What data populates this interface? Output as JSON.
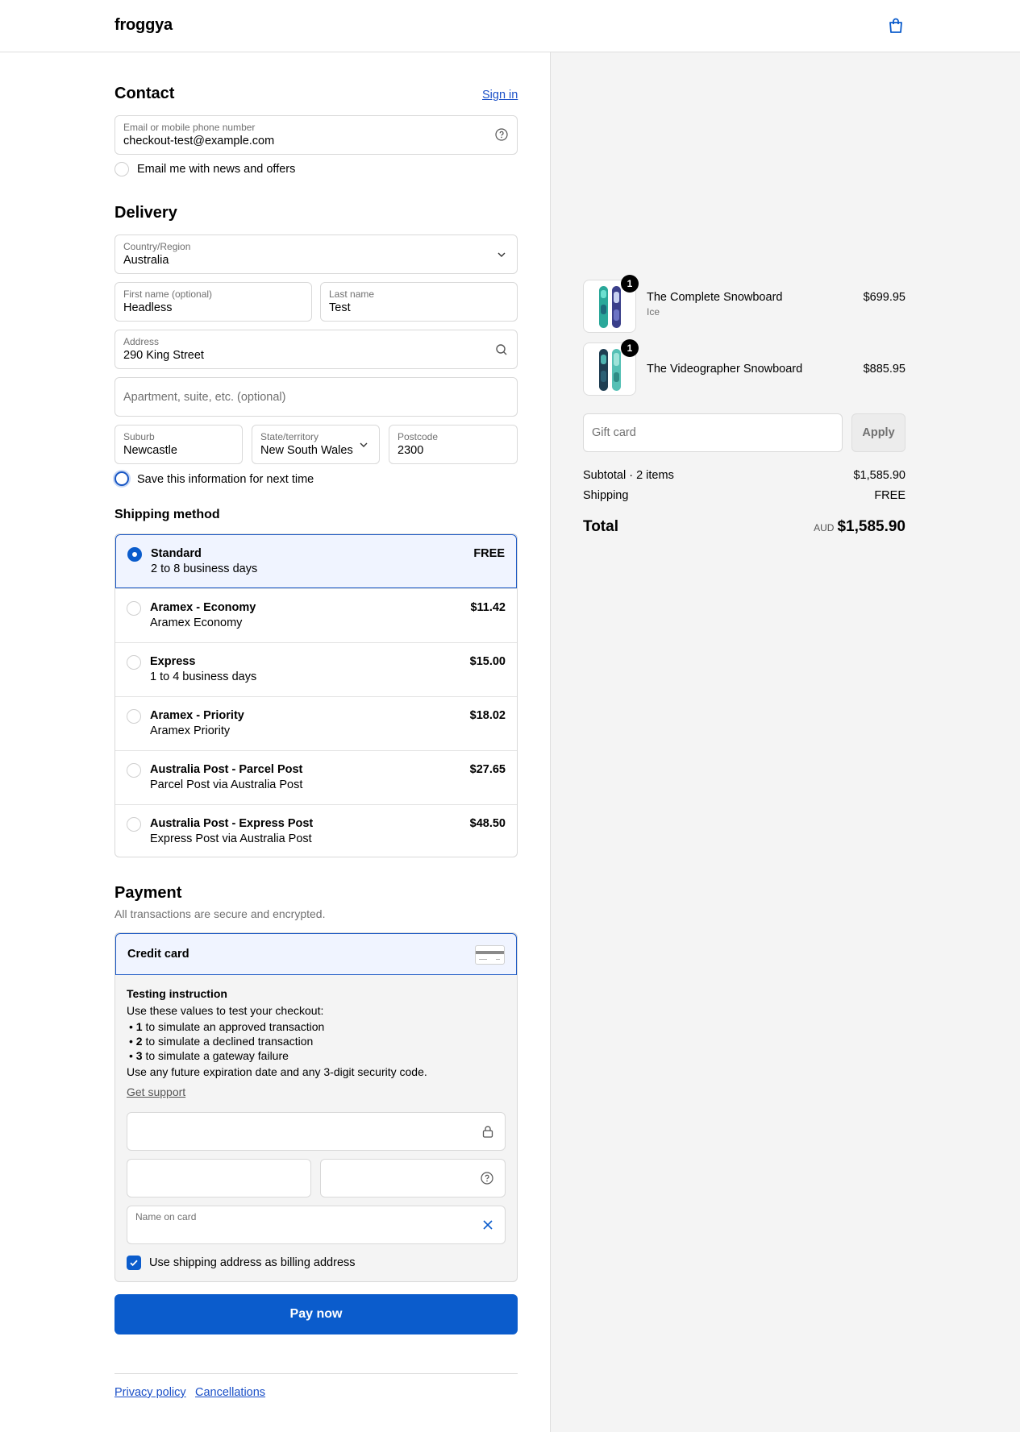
{
  "header": {
    "logo": "froggya",
    "cart_icon": "shopping-bag-icon"
  },
  "contact": {
    "title": "Contact",
    "sign_in": "Sign in",
    "email_label": "Email or mobile phone number",
    "email_value": "checkout-test@example.com",
    "help_icon": "question-circle-icon",
    "news_label": "Email me with news and offers"
  },
  "delivery": {
    "title": "Delivery",
    "country_label": "Country/Region",
    "country_value": "Australia",
    "first_name_label": "First name (optional)",
    "first_name_value": "Headless",
    "last_name_label": "Last name",
    "last_name_value": "Test",
    "address_label": "Address",
    "address_value": "290 King Street",
    "apartment_placeholder": "Apartment, suite, etc. (optional)",
    "suburb_label": "Suburb",
    "suburb_value": "Newcastle",
    "state_label": "State/territory",
    "state_value": "New South Wales",
    "postcode_label": "Postcode",
    "postcode_value": "2300",
    "save_label": "Save this information for next time"
  },
  "shipping": {
    "title": "Shipping method",
    "options": [
      {
        "name": "Standard",
        "desc": "2 to 8 business days",
        "price": "FREE",
        "selected": true
      },
      {
        "name": "Aramex - Economy",
        "desc": "Aramex Economy",
        "price": "$11.42",
        "selected": false
      },
      {
        "name": "Express",
        "desc": "1 to 4 business days",
        "price": "$15.00",
        "selected": false
      },
      {
        "name": "Aramex - Priority",
        "desc": "Aramex Priority",
        "price": "$18.02",
        "selected": false
      },
      {
        "name": "Australia Post - Parcel Post",
        "desc": "Parcel Post via Australia Post",
        "price": "$27.65",
        "selected": false
      },
      {
        "name": "Australia Post - Express Post",
        "desc": "Express Post via Australia Post",
        "price": "$48.50",
        "selected": false
      }
    ]
  },
  "payment": {
    "title": "Payment",
    "subtitle": "All transactions are secure and encrypted.",
    "method": "Credit card",
    "instruction_title": "Testing instruction",
    "instruction_intro": "Use these values to test your checkout:",
    "instructions": [
      {
        "num": "1",
        "text": " to simulate an approved transaction"
      },
      {
        "num": "2",
        "text": " to simulate a declined transaction"
      },
      {
        "num": "3",
        "text": " to simulate a gateway failure"
      }
    ],
    "instruction_outro": "Use any future expiration date and any 3-digit security code.",
    "support_link": "Get support",
    "name_on_card_label": "Name on card",
    "billing_label": "Use shipping address as billing address",
    "pay_button": "Pay now"
  },
  "footer": {
    "privacy": "Privacy policy",
    "cancellations": "Cancellations"
  },
  "summary": {
    "items": [
      {
        "name": "The Complete Snowboard",
        "variant": "Ice",
        "price": "$699.95",
        "qty": "1"
      },
      {
        "name": "The Videographer Snowboard",
        "variant": "",
        "price": "$885.95",
        "qty": "1"
      }
    ],
    "gift_placeholder": "Gift card",
    "apply": "Apply",
    "subtotal_label": "Subtotal · 2 items",
    "subtotal_value": "$1,585.90",
    "shipping_label": "Shipping",
    "shipping_value": "FREE",
    "total_label": "Total",
    "currency": "AUD",
    "total_value": "$1,585.90"
  },
  "colors": {
    "accent": "#0b5ccc",
    "link": "#1a4fc7",
    "panel": "#f4f4f4"
  }
}
